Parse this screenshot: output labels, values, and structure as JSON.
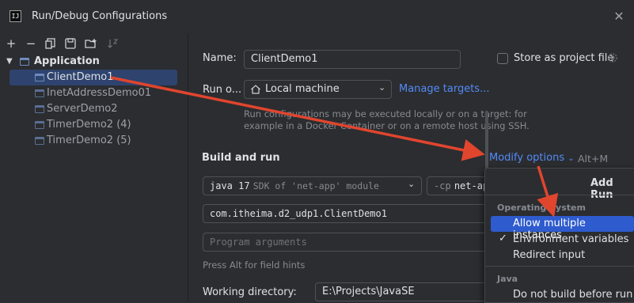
{
  "window": {
    "title": "Run/Debug Configurations",
    "logo": "IJ"
  },
  "toolbar": {
    "icons": [
      "add-icon",
      "remove-icon",
      "copy-icon",
      "save-icon",
      "new-folder-icon",
      "sort-icon"
    ]
  },
  "tree": {
    "group_label": "Application",
    "items": [
      {
        "label": "ClientDemo1",
        "selected": true
      },
      {
        "label": "InetAddressDemo01"
      },
      {
        "label": "ServerDemo2"
      },
      {
        "label": "TimerDemo2 (4)"
      },
      {
        "label": "TimerDemo2 (5)"
      }
    ]
  },
  "form": {
    "name_label": "Name:",
    "name_value": "ClientDemo1",
    "store_label": "Store as project file",
    "run_on_label": "Run o...",
    "run_on_value": "Local machine",
    "manage_targets": "Manage targets...",
    "run_hint_1": "Run configurations may be executed locally or on a target: for",
    "run_hint_2": "example in a Docker Container or on a remote host using SSH.",
    "build_run_title": "Build and run",
    "modify_options": "Modify options",
    "modify_shortcut": "Alt+M",
    "jdk_version": "java 17",
    "jdk_desc": "SDK of 'net-app' module",
    "cp_prefix": "-cp",
    "cp_value": "net-ap",
    "main_class": "com.itheima.d2_udp1.ClientDemo1",
    "program_args_placeholder": "Program arguments",
    "field_hint": "Press Alt for field hints",
    "working_dir_label": "Working directory:",
    "working_dir_value": "E:\\Projects\\JavaSE"
  },
  "popup": {
    "title": "Add Run",
    "section_os": "Operating System",
    "items_os": [
      {
        "label": "Allow multiple instances",
        "highlighted": true
      },
      {
        "label": "Environment variables",
        "checked": true
      },
      {
        "label": "Redirect input"
      }
    ],
    "section_java": "Java",
    "items_java": [
      {
        "label": "Do not build before run"
      }
    ]
  },
  "colors": {
    "accent": "#548af7",
    "selection": "#2e436e",
    "highlight": "#2e5bce",
    "annotation_arrow": "#e0452e"
  }
}
